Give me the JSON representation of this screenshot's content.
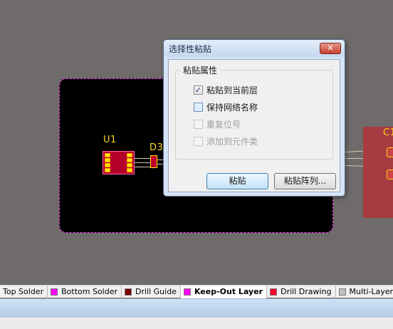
{
  "pcb": {
    "u1_label": "U1",
    "d3_label": "D3",
    "c1_label": "C1"
  },
  "dialog": {
    "title": "选择性粘贴",
    "close_icon": "close-icon",
    "group_label": "粘贴属性",
    "options": [
      {
        "label": "粘贴到当前层",
        "checked": true,
        "enabled": true
      },
      {
        "label": "保持网络名称",
        "checked": false,
        "enabled": true
      },
      {
        "label": "重复位号",
        "checked": false,
        "enabled": false
      },
      {
        "label": "添加到元件类",
        "checked": false,
        "enabled": false
      }
    ],
    "paste_button": "粘贴",
    "paste_array_button": "粘贴阵列..."
  },
  "layer_tabs": [
    {
      "label": "Top Solder",
      "color": "#00000000",
      "active": false
    },
    {
      "label": "Bottom Solder",
      "color": "#ff00ff",
      "active": false
    },
    {
      "label": "Drill Guide",
      "color": "#800000",
      "active": false
    },
    {
      "label": "Keep-Out Layer",
      "color": "#ff00ff",
      "active": true
    },
    {
      "label": "Drill Drawing",
      "color": "#ff002a",
      "active": false
    },
    {
      "label": "Multi-Layer",
      "color": "#c0c0c0",
      "active": false
    }
  ]
}
